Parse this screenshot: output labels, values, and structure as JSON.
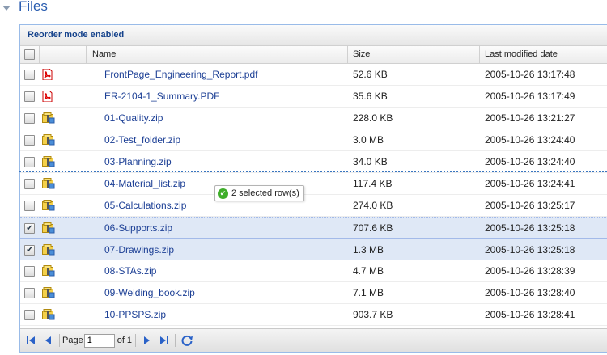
{
  "section": {
    "title": "Files"
  },
  "grid": {
    "title": "Reorder mode enabled",
    "columns": {
      "name": "Name",
      "size": "Size",
      "date": "Last modified date"
    },
    "rows": [
      {
        "name": "FrontPage_Engineering_Report.pdf",
        "size": "52.6 KB",
        "date": "2005-10-26 13:17:48",
        "type": "pdf",
        "checked": false
      },
      {
        "name": "ER-2104-1_Summary.PDF",
        "size": "35.6 KB",
        "date": "2005-10-26 13:17:49",
        "type": "pdf",
        "checked": false
      },
      {
        "name": "01-Quality.zip",
        "size": "228.0 KB",
        "date": "2005-10-26 13:21:27",
        "type": "zip",
        "checked": false
      },
      {
        "name": "02-Test_folder.zip",
        "size": "3.0 MB",
        "date": "2005-10-26 13:24:40",
        "type": "zip",
        "checked": false
      },
      {
        "name": "03-Planning.zip",
        "size": "34.0 KB",
        "date": "2005-10-26 13:24:40",
        "type": "zip",
        "checked": false
      },
      {
        "name": "04-Material_list.zip",
        "size": "117.4 KB",
        "date": "2005-10-26 13:24:41",
        "type": "zip",
        "checked": false
      },
      {
        "name": "05-Calculations.zip",
        "size": "274.0 KB",
        "date": "2005-10-26 13:25:17",
        "type": "zip",
        "checked": false
      },
      {
        "name": "06-Supports.zip",
        "size": "707.6 KB",
        "date": "2005-10-26 13:25:18",
        "type": "zip",
        "checked": true
      },
      {
        "name": "07-Drawings.zip",
        "size": "1.3 MB",
        "date": "2005-10-26 13:25:18",
        "type": "zip",
        "checked": true
      },
      {
        "name": "08-STAs.zip",
        "size": "4.7 MB",
        "date": "2005-10-26 13:28:39",
        "type": "zip",
        "checked": false
      },
      {
        "name": "09-Welding_book.zip",
        "size": "7.1 MB",
        "date": "2005-10-26 13:28:40",
        "type": "zip",
        "checked": false
      },
      {
        "name": "10-PPSPS.zip",
        "size": "903.7 KB",
        "date": "2005-10-26 13:28:41",
        "type": "zip",
        "checked": false
      }
    ]
  },
  "drag_badge": {
    "text": "2 selected row(s)"
  },
  "pager": {
    "page_label": "Page",
    "page_value": "1",
    "of_label": "of 1"
  },
  "icons": {
    "pdf": "pdf-file-icon",
    "zip": "zip-archive-icon",
    "check": "checkmark-icon"
  },
  "colors": {
    "link": "#1c3f95",
    "selected_row": "#dfe8f6",
    "title": "#2a5db0"
  }
}
